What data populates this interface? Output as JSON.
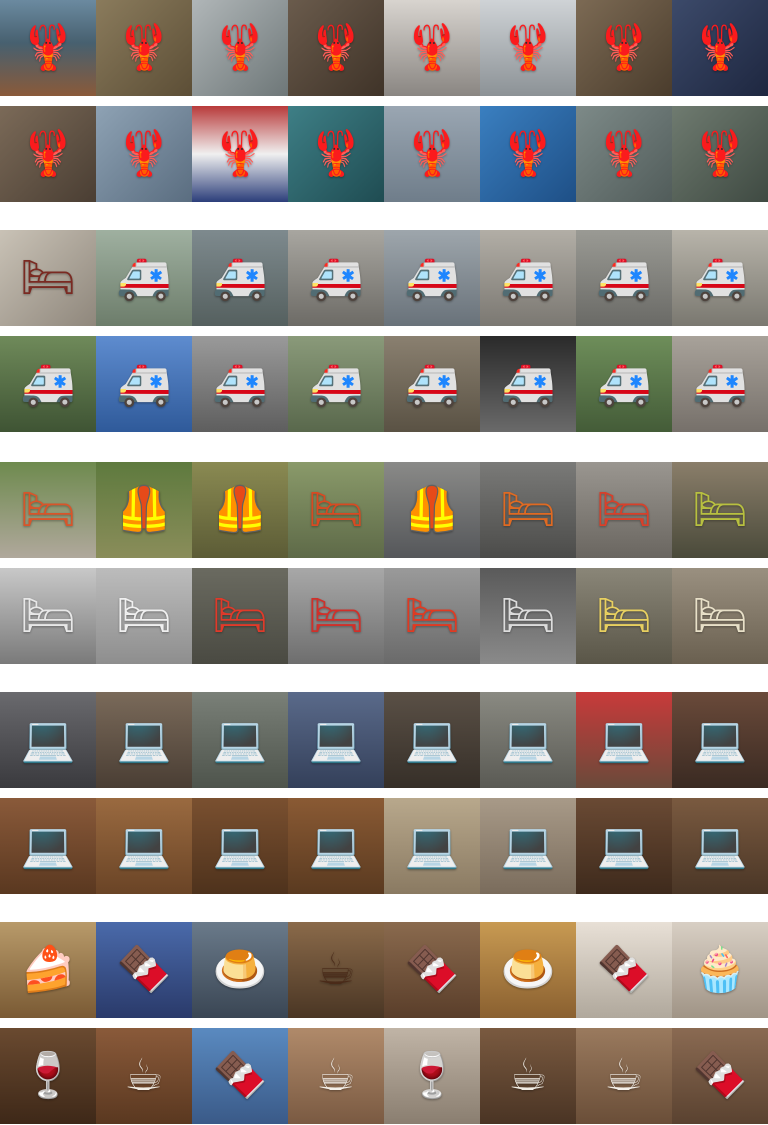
{
  "grid": {
    "blocks": [
      {
        "name": "lobster",
        "rows": [
          {
            "tiles": [
              {
                "bg": "linear-gradient(180deg,#6b8aa0 0%,#47606f 45%,#8a5a3a 100%)",
                "glyph": "🦞",
                "color": "#d8351c"
              },
              {
                "bg": "linear-gradient(135deg,#8a7b5c,#5c4e36)",
                "glyph": "🦞",
                "color": "#c9a23a"
              },
              {
                "bg": "linear-gradient(135deg,#b0b6b8,#6e7778)",
                "glyph": "🦞",
                "color": "#c7321b"
              },
              {
                "bg": "linear-gradient(135deg,#6a5b4c,#3f3328)",
                "glyph": "🦞",
                "color": "#e0401f"
              },
              {
                "bg": "linear-gradient(180deg,#d8d4cf,#8a8682)",
                "glyph": "🦞",
                "color": "#d2301c"
              },
              {
                "bg": "linear-gradient(180deg,#cfd3d6,#8c9296)",
                "glyph": "🦞",
                "color": "#cf2e1b"
              },
              {
                "bg": "linear-gradient(135deg,#7c6a54,#4a3c2c)",
                "glyph": "🦞",
                "color": "#d8341d"
              },
              {
                "bg": "linear-gradient(135deg,#3c4a6a,#1e2740)",
                "glyph": "🦞",
                "color": "#e13c22"
              }
            ]
          },
          {
            "tiles": [
              {
                "bg": "linear-gradient(135deg,#7b6a58,#4a3e33)",
                "glyph": "🦞",
                "color": "#d6321b"
              },
              {
                "bg": "linear-gradient(135deg,#8ea2b4,#5a6d80)",
                "glyph": "🦞",
                "color": "#cf2f1b"
              },
              {
                "bg": "linear-gradient(180deg,#b83a3a 0%,#f0f0f0 50%,#2c3e7a 100%)",
                "glyph": "🦞",
                "color": "#2a2f4a"
              },
              {
                "bg": "linear-gradient(135deg,#3e7f86,#1f4c52)",
                "glyph": "🦞",
                "color": "#d8381e"
              },
              {
                "bg": "linear-gradient(180deg,#9aa6b2,#6f7d8a)",
                "glyph": "🦞",
                "color": "#c82d1a"
              },
              {
                "bg": "linear-gradient(135deg,#3a7fc0,#1e4f86)",
                "glyph": "🦞",
                "color": "#e0451f"
              },
              {
                "bg": "linear-gradient(135deg,#7d8a88,#515c5a)",
                "glyph": "🦞",
                "color": "#c5301c"
              },
              {
                "bg": "linear-gradient(135deg,#6f7b70,#3f4a42)",
                "glyph": "🦞",
                "color": "#c52c1a"
              }
            ]
          }
        ]
      },
      {
        "name": "ambulance",
        "rows": [
          {
            "tiles": [
              {
                "bg": "linear-gradient(135deg,#c9c2b6,#8f877c)",
                "glyph": "🛏",
                "color": "#7a2a22"
              },
              {
                "bg": "linear-gradient(180deg,#9fb0a0,#6d7d6b)",
                "glyph": "🚑",
                "color": "#ffffff"
              },
              {
                "bg": "linear-gradient(180deg,#7e8a8e,#55605f)",
                "glyph": "🚑",
                "color": "#ffffff"
              },
              {
                "bg": "linear-gradient(180deg,#a8a6a0,#6d6b66)",
                "glyph": "🚑",
                "color": "#ffffff"
              },
              {
                "bg": "linear-gradient(180deg,#9ea6ac,#69727a)",
                "glyph": "🚑",
                "color": "#ffffff"
              },
              {
                "bg": "linear-gradient(180deg,#b2aea6,#7b7872)",
                "glyph": "🚑",
                "color": "#ffffff"
              },
              {
                "bg": "linear-gradient(180deg,#9a9a94,#6a6a66)",
                "glyph": "🚑",
                "color": "#ffffff"
              },
              {
                "bg": "linear-gradient(180deg,#b8b4aa,#7a7870)",
                "glyph": "🚑",
                "color": "#ffffff"
              }
            ]
          },
          {
            "tiles": [
              {
                "bg": "linear-gradient(180deg,#6f8a5a,#3f5434)",
                "glyph": "🚑",
                "color": "#ffffff"
              },
              {
                "bg": "linear-gradient(180deg,#5e8ccf,#2f5a9a)",
                "glyph": "🚑",
                "color": "#ffffff"
              },
              {
                "bg": "linear-gradient(180deg,#9a9a9a,#5e5e5e)",
                "glyph": "🚑",
                "color": "#ffffff"
              },
              {
                "bg": "linear-gradient(180deg,#8a9a7a,#59684c)",
                "glyph": "🚑",
                "color": "#ffffff"
              },
              {
                "bg": "linear-gradient(180deg,#8a8070,#5a5244)",
                "glyph": "🚑",
                "color": "#ffffff"
              },
              {
                "bg": "linear-gradient(180deg,#2a2a2a,#6a6a6a)",
                "glyph": "🚑",
                "color": "#ffffff"
              },
              {
                "bg": "linear-gradient(180deg,#6e8e5a,#445c38)",
                "glyph": "🚑",
                "color": "#ffffff"
              },
              {
                "bg": "linear-gradient(180deg,#a8a29a,#76706a)",
                "glyph": "🚑",
                "color": "#ffffff"
              }
            ]
          }
        ]
      },
      {
        "name": "stretcher",
        "rows": [
          {
            "tiles": [
              {
                "bg": "linear-gradient(180deg,#6e8a4e,#b0a89c)",
                "glyph": "🛏",
                "color": "#d8552a"
              },
              {
                "bg": "linear-gradient(180deg,#5e7a3e,#8a8d5a)",
                "glyph": "🦺",
                "color": "#d6e020"
              },
              {
                "bg": "linear-gradient(180deg,#8a8a52,#5c5c36)",
                "glyph": "🦺",
                "color": "#e8701e"
              },
              {
                "bg": "linear-gradient(180deg,#8a9a6a,#5e6a48)",
                "glyph": "🛏",
                "color": "#d84a22"
              },
              {
                "bg": "linear-gradient(180deg,#8a8a88,#55575a)",
                "glyph": "🦺",
                "color": "#e8601e"
              },
              {
                "bg": "linear-gradient(180deg,#7a7a78,#4c4c4a)",
                "glyph": "🛏",
                "color": "#e06a22"
              },
              {
                "bg": "linear-gradient(180deg,#9a9690,#6a6660)",
                "glyph": "🛏",
                "color": "#d8402a"
              },
              {
                "bg": "linear-gradient(180deg,#8a7e6a,#4a4a3a)",
                "glyph": "🛏",
                "color": "#b8c040"
              }
            ]
          },
          {
            "tiles": [
              {
                "bg": "linear-gradient(180deg,#c8c8c8,#7a7a7a)",
                "glyph": "🛏",
                "color": "#e8e8e8"
              },
              {
                "bg": "linear-gradient(180deg,#bcbcbc,#8e8e8e)",
                "glyph": "🛏",
                "color": "#f0f0f0"
              },
              {
                "bg": "linear-gradient(180deg,#6a6a60,#4a4a42)",
                "glyph": "🛏",
                "color": "#e03a2a"
              },
              {
                "bg": "linear-gradient(180deg,#a8a8a8,#6e6e6e)",
                "glyph": "🛏",
                "color": "#d0302a"
              },
              {
                "bg": "linear-gradient(180deg,#9a9a9a,#6a6a6a)",
                "glyph": "🛏",
                "color": "#e03a22"
              },
              {
                "bg": "linear-gradient(180deg,#5a5a5a,#8a8a8a)",
                "glyph": "🛏",
                "color": "#dcdcdc"
              },
              {
                "bg": "linear-gradient(180deg,#8a8678,#5a5648)",
                "glyph": "🛏",
                "color": "#e8d060"
              },
              {
                "bg": "linear-gradient(180deg,#9a9080,#6a6050)",
                "glyph": "🛏",
                "color": "#e8e0c8"
              }
            ]
          }
        ]
      },
      {
        "name": "laptop",
        "rows": [
          {
            "tiles": [
              {
                "bg": "linear-gradient(180deg,#6a6a6e,#3a3a3e)",
                "glyph": "💻",
                "color": "#e060a0"
              },
              {
                "bg": "linear-gradient(180deg,#7a6a5a,#4a3e34)",
                "glyph": "💻",
                "color": "#d8d8d8"
              },
              {
                "bg": "linear-gradient(180deg,#7a8078,#4e544c)",
                "glyph": "💻",
                "color": "#cfcfcf"
              },
              {
                "bg": "linear-gradient(180deg,#5a6a8a,#34405a)",
                "glyph": "💻",
                "color": "#c8c8c8"
              },
              {
                "bg": "linear-gradient(180deg,#5a5046,#362f28)",
                "glyph": "💻",
                "color": "#c0c0c0"
              },
              {
                "bg": "linear-gradient(180deg,#8a8a82,#5a5a54)",
                "glyph": "💻",
                "color": "#d0d0d0"
              },
              {
                "bg": "linear-gradient(180deg,#c83a3a,#6a4a3a)",
                "glyph": "💻",
                "color": "#f0f0f0"
              },
              {
                "bg": "linear-gradient(180deg,#6a4a3a,#3a2a22)",
                "glyph": "💻",
                "color": "#d0d0d0"
              }
            ]
          },
          {
            "tiles": [
              {
                "bg": "linear-gradient(180deg,#8a5a3a,#5a3820)",
                "glyph": "💻",
                "color": "#c8c8c8"
              },
              {
                "bg": "linear-gradient(180deg,#9a6a40,#6a4426)",
                "glyph": "💻",
                "color": "#d0d0d0"
              },
              {
                "bg": "linear-gradient(180deg,#7a5030,#4e321c)",
                "glyph": "💻",
                "color": "#d8d8d8"
              },
              {
                "bg": "linear-gradient(180deg,#8a5a34,#5a3a20)",
                "glyph": "💻",
                "color": "#d8d8d8"
              },
              {
                "bg": "linear-gradient(180deg,#b8a88c,#8a7a62)",
                "glyph": "💻",
                "color": "#dcdcdc"
              },
              {
                "bg": "linear-gradient(180deg,#a89a88,#7a6c5c)",
                "glyph": "💻",
                "color": "#dcdcdc"
              },
              {
                "bg": "linear-gradient(180deg,#6a4a34,#3e2a1c)",
                "glyph": "💻",
                "color": "#cfcfcf"
              },
              {
                "bg": "linear-gradient(180deg,#7a5a40,#4a3626)",
                "glyph": "💻",
                "color": "#d0d0d0"
              }
            ]
          }
        ]
      },
      {
        "name": "chocolate",
        "rows": [
          {
            "tiles": [
              {
                "bg": "linear-gradient(180deg,#b89a6a,#7a5a34)",
                "glyph": "🍰",
                "color": "#4a2414"
              },
              {
                "bg": "linear-gradient(180deg,#4a6aaa,#2a3a6a)",
                "glyph": "🍫",
                "color": "#6a3418"
              },
              {
                "bg": "linear-gradient(180deg,#6a7a8a,#3a4654)",
                "glyph": "🍮",
                "color": "#c88a3a"
              },
              {
                "bg": "linear-gradient(180deg,#8a6a4a,#4a3624)",
                "glyph": "☕",
                "color": "#4a2a18"
              },
              {
                "bg": "linear-gradient(180deg,#8a6a4e,#5a3e2a)",
                "glyph": "🍫",
                "color": "#3a1c0e"
              },
              {
                "bg": "linear-gradient(180deg,#c89a52,#8a6030)",
                "glyph": "🍮",
                "color": "#5a2e14"
              },
              {
                "bg": "linear-gradient(180deg,#e8e0d6,#b0a89c)",
                "glyph": "🍫",
                "color": "#4a2212"
              },
              {
                "bg": "linear-gradient(180deg,#d8cfc4,#a09486)",
                "glyph": "🧁",
                "color": "#c89a48"
              }
            ]
          },
          {
            "tiles": [
              {
                "bg": "linear-gradient(180deg,#6a4a30,#3e2818)",
                "glyph": "🍷",
                "color": "#3a1a0c"
              },
              {
                "bg": "linear-gradient(180deg,#8a5a3a,#5a3820)",
                "glyph": "☕",
                "color": "#f0ece4"
              },
              {
                "bg": "linear-gradient(180deg,#5a8ac0,#3a5a88)",
                "glyph": "🍫",
                "color": "#4a2212"
              },
              {
                "bg": "linear-gradient(180deg,#b08a6a,#7a5a42)",
                "glyph": "☕",
                "color": "#f4f0ea"
              },
              {
                "bg": "linear-gradient(180deg,#c0b4a6,#8a7e70)",
                "glyph": "🍷",
                "color": "#3a1a0c"
              },
              {
                "bg": "linear-gradient(180deg,#7a5a40,#4a3424)",
                "glyph": "☕",
                "color": "#f0ece4"
              },
              {
                "bg": "linear-gradient(180deg,#9a7a5e,#6a4e38)",
                "glyph": "☕",
                "color": "#f4f0ea"
              },
              {
                "bg": "linear-gradient(180deg,#8a6a52,#5a4230)",
                "glyph": "🍫",
                "color": "#3a1a0c"
              }
            ]
          }
        ]
      }
    ]
  }
}
